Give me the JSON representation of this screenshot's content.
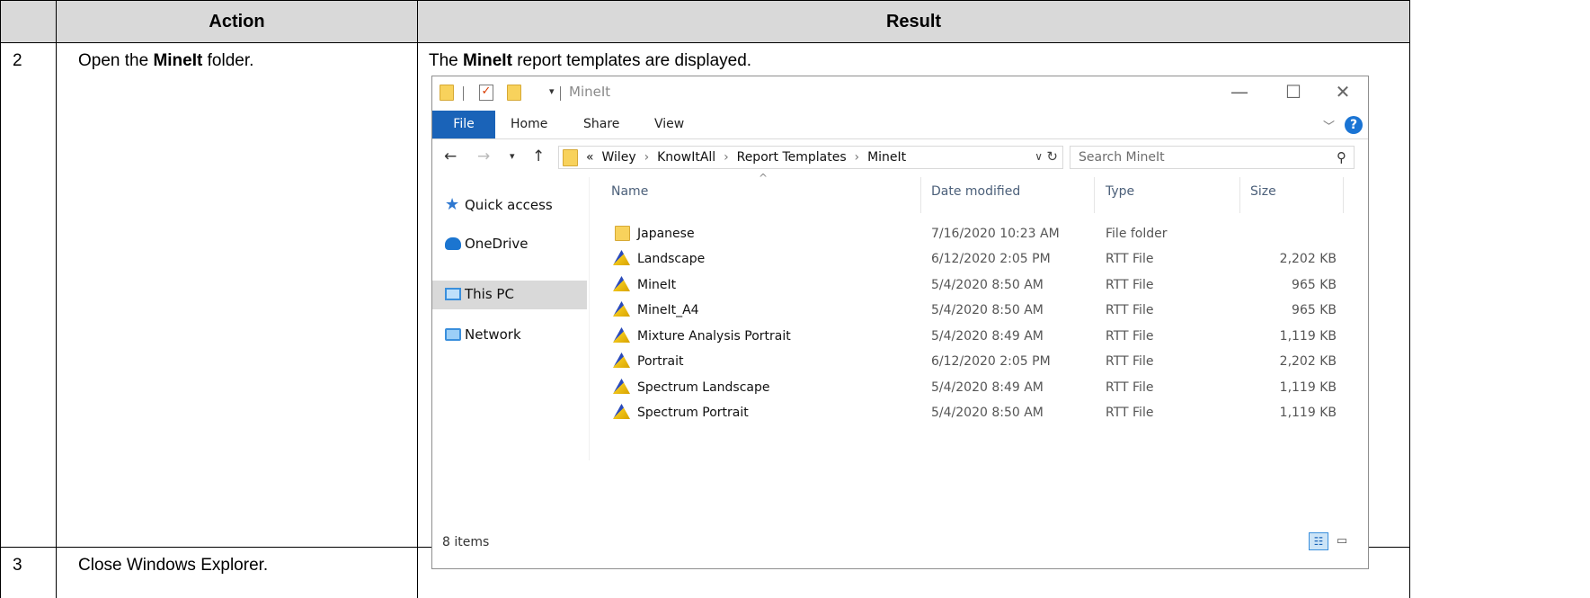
{
  "table": {
    "headers": {
      "action": "Action",
      "result": "Result"
    },
    "rows": [
      {
        "step": "2",
        "action_prefix": "Open the ",
        "action_bold": "MineIt",
        "action_suffix": " folder.",
        "result_prefix": "The ",
        "result_bold": "MineIt",
        "result_suffix": " report templates are displayed."
      },
      {
        "step": "3",
        "action_text": "Close Windows Explorer."
      }
    ]
  },
  "explorer": {
    "title": "MineIt",
    "window_buttons": {
      "minimize": "—",
      "maximize": "☐",
      "close": "✕"
    },
    "ribbon_tabs": [
      "File",
      "Home",
      "Share",
      "View"
    ],
    "address": {
      "prefix": "«",
      "segments": [
        "Wiley",
        "KnowItAll",
        "Report Templates",
        "MineIt"
      ],
      "separator": "›"
    },
    "search_placeholder": "Search MineIt",
    "nav_items": [
      {
        "label": "Quick access",
        "icon": "star-icon"
      },
      {
        "label": "OneDrive",
        "icon": "cloud-icon"
      },
      {
        "label": "This PC",
        "icon": "computer-icon",
        "selected": true
      },
      {
        "label": "Network",
        "icon": "network-icon"
      }
    ],
    "columns": {
      "name": "Name",
      "date": "Date modified",
      "type": "Type",
      "size": "Size"
    },
    "files": [
      {
        "name": "Japanese",
        "date": "7/16/2020 10:23 AM",
        "type": "File folder",
        "size": "",
        "icon": "folder-icon"
      },
      {
        "name": "Landscape",
        "date": "6/12/2020 2:05 PM",
        "type": "RTT File",
        "size": "2,202 KB",
        "icon": "rtt-file-icon"
      },
      {
        "name": "MineIt",
        "date": "5/4/2020 8:50 AM",
        "type": "RTT File",
        "size": "965 KB",
        "icon": "rtt-file-icon"
      },
      {
        "name": "MineIt_A4",
        "date": "5/4/2020 8:50 AM",
        "type": "RTT File",
        "size": "965 KB",
        "icon": "rtt-file-icon"
      },
      {
        "name": "Mixture Analysis Portrait",
        "date": "5/4/2020 8:49 AM",
        "type": "RTT File",
        "size": "1,119 KB",
        "icon": "rtt-file-icon"
      },
      {
        "name": "Portrait",
        "date": "6/12/2020 2:05 PM",
        "type": "RTT File",
        "size": "2,202 KB",
        "icon": "rtt-file-icon"
      },
      {
        "name": "Spectrum Landscape",
        "date": "5/4/2020 8:49 AM",
        "type": "RTT File",
        "size": "1,119 KB",
        "icon": "rtt-file-icon"
      },
      {
        "name": "Spectrum Portrait",
        "date": "5/4/2020 8:50 AM",
        "type": "RTT File",
        "size": "1,119 KB",
        "icon": "rtt-file-icon"
      }
    ],
    "status": "8 items",
    "colors": {
      "accent": "#1a63b8",
      "selected_bg": "#d9d9d9",
      "header_bg": "#d9d9d9"
    }
  }
}
